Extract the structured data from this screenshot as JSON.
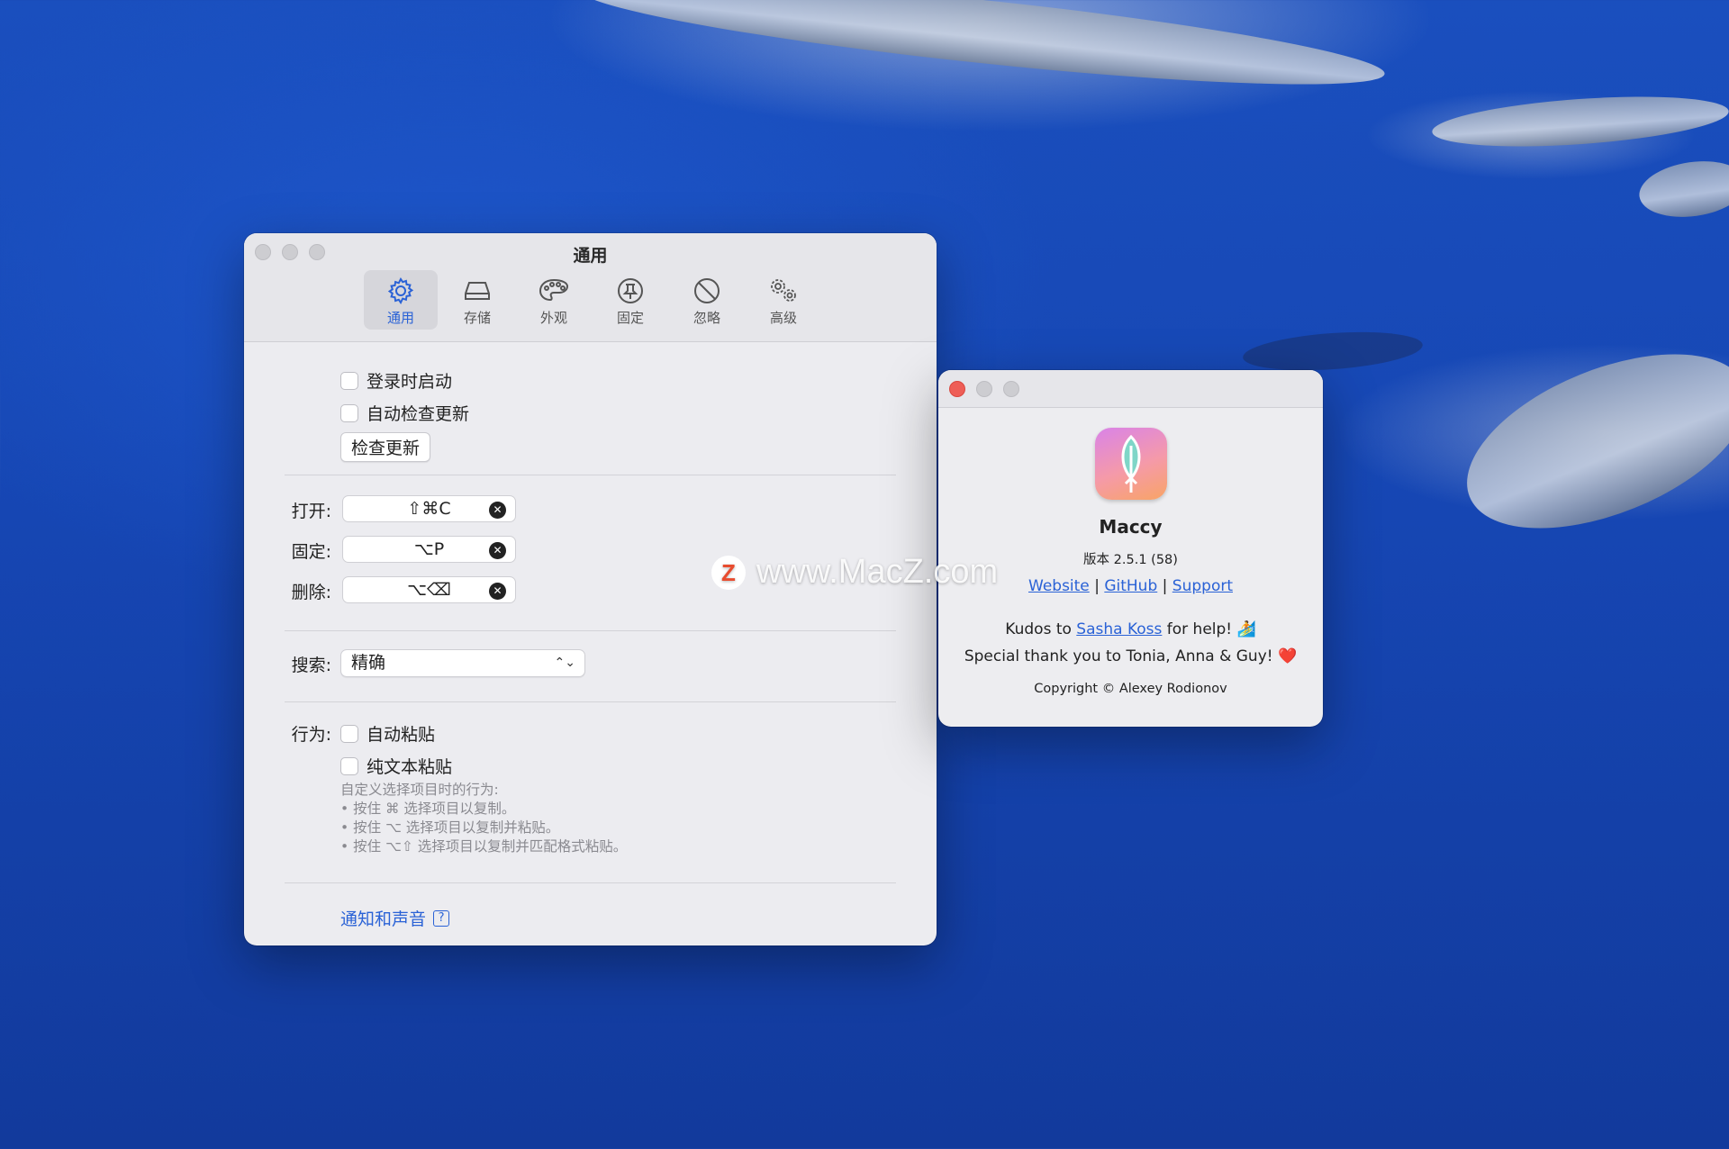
{
  "prefs_window": {
    "title": "通用",
    "tabs": [
      {
        "label": "通用",
        "icon": "gear-icon"
      },
      {
        "label": "存储",
        "icon": "storage-icon"
      },
      {
        "label": "外观",
        "icon": "palette-icon"
      },
      {
        "label": "固定",
        "icon": "pin-icon"
      },
      {
        "label": "忽略",
        "icon": "prohibit-icon"
      },
      {
        "label": "高级",
        "icon": "gears-icon"
      }
    ],
    "general": {
      "launch_at_login": "登录时启动",
      "auto_check_updates": "自动检查更新",
      "check_updates_button": "检查更新"
    },
    "shortcuts": {
      "open_label": "打开:",
      "open_value": "⇧⌘C",
      "pin_label": "固定:",
      "pin_value": "⌥P",
      "delete_label": "删除:",
      "delete_value": "⌥⌫"
    },
    "search": {
      "label": "搜索:",
      "value": "精确"
    },
    "behavior": {
      "label": "行为:",
      "auto_paste": "自动粘贴",
      "plain_text_paste": "纯文本粘贴",
      "hint_title": "自定义选择项目时的行为:",
      "hint_1": "• 按住 ⌘ 选择项目以复制。",
      "hint_2": "• 按住 ⌥ 选择项目以复制并粘贴。",
      "hint_3": "• 按住 ⌥⇧ 选择项目以复制并匹配格式粘贴。"
    },
    "notifications_link": "通知和声音",
    "help_icon": "?"
  },
  "about_window": {
    "app_name": "Maccy",
    "version": "版本 2.5.1 (58)",
    "links": {
      "website": "Website",
      "github": "GitHub",
      "support": "Support",
      "sep": "|"
    },
    "kudos_prefix": "Kudos to ",
    "kudos_name": "Sasha Koss",
    "kudos_suffix": " for help! 🏄",
    "thanks": "Special thank you to Tonia, Anna & Guy! ❤️",
    "copyright": "Copyright © Alexey Rodionov"
  },
  "watermark": {
    "logo": "Z",
    "text": "www.MacZ.com"
  },
  "colors": {
    "accent": "#2a62d6",
    "window_bg": "#ececf0",
    "desktop_blue": "#1a4fbe",
    "close_red": "#ee5e57"
  }
}
